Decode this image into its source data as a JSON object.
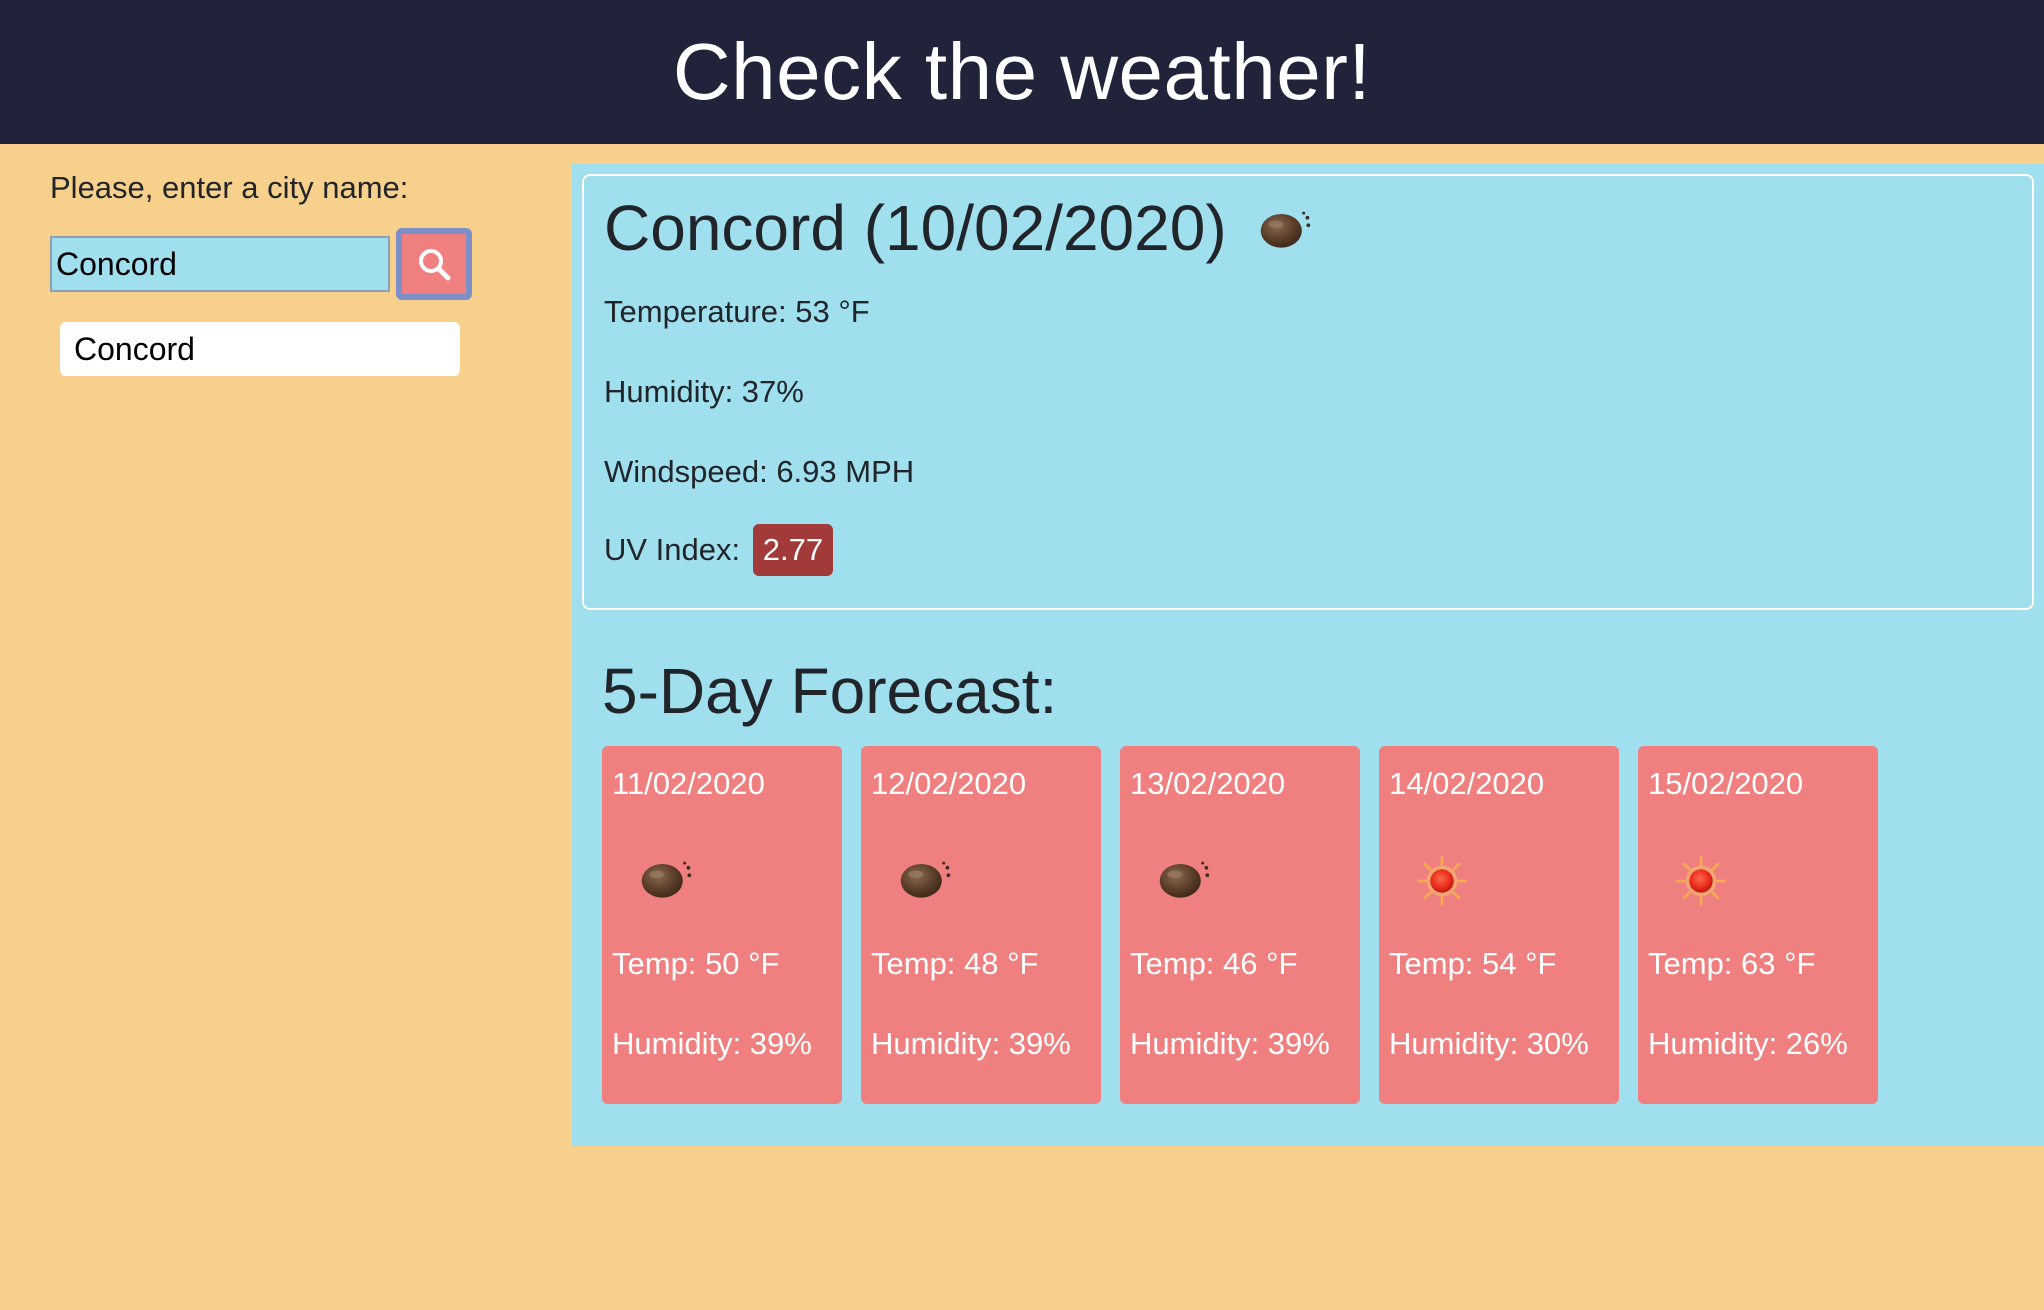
{
  "header": {
    "title": "Check the weather!"
  },
  "sidebar": {
    "prompt": "Please, enter a city name:",
    "search_value": "Concord",
    "history": [
      "Concord"
    ]
  },
  "current": {
    "heading": "Concord (10/02/2020)",
    "icon": "cloud-icon",
    "temperature": "Temperature: 53 °F",
    "humidity": "Humidity: 37%",
    "windspeed": "Windspeed: 6.93 MPH",
    "uv_label": "UV Index:",
    "uv_value": "2.77",
    "uv_color": "#a33a3a"
  },
  "forecast": {
    "title": "5-Day Forecast:",
    "days": [
      {
        "date": "11/02/2020",
        "icon": "cloud-icon",
        "temp": "Temp: 50 °F",
        "humidity": "Humidity: 39%"
      },
      {
        "date": "12/02/2020",
        "icon": "cloud-icon",
        "temp": "Temp: 48 °F",
        "humidity": "Humidity: 39%"
      },
      {
        "date": "13/02/2020",
        "icon": "cloud-icon",
        "temp": "Temp: 46 °F",
        "humidity": "Humidity: 39%"
      },
      {
        "date": "14/02/2020",
        "icon": "sun-icon",
        "temp": "Temp: 54 °F",
        "humidity": "Humidity: 30%"
      },
      {
        "date": "15/02/2020",
        "icon": "sun-icon",
        "temp": "Temp: 63 °F",
        "humidity": "Humidity: 26%"
      }
    ]
  },
  "colors": {
    "header_bg": "#20233a",
    "page_bg": "#f7d08c",
    "panel_bg": "#9fdfee",
    "card_bg": "#f08080"
  }
}
